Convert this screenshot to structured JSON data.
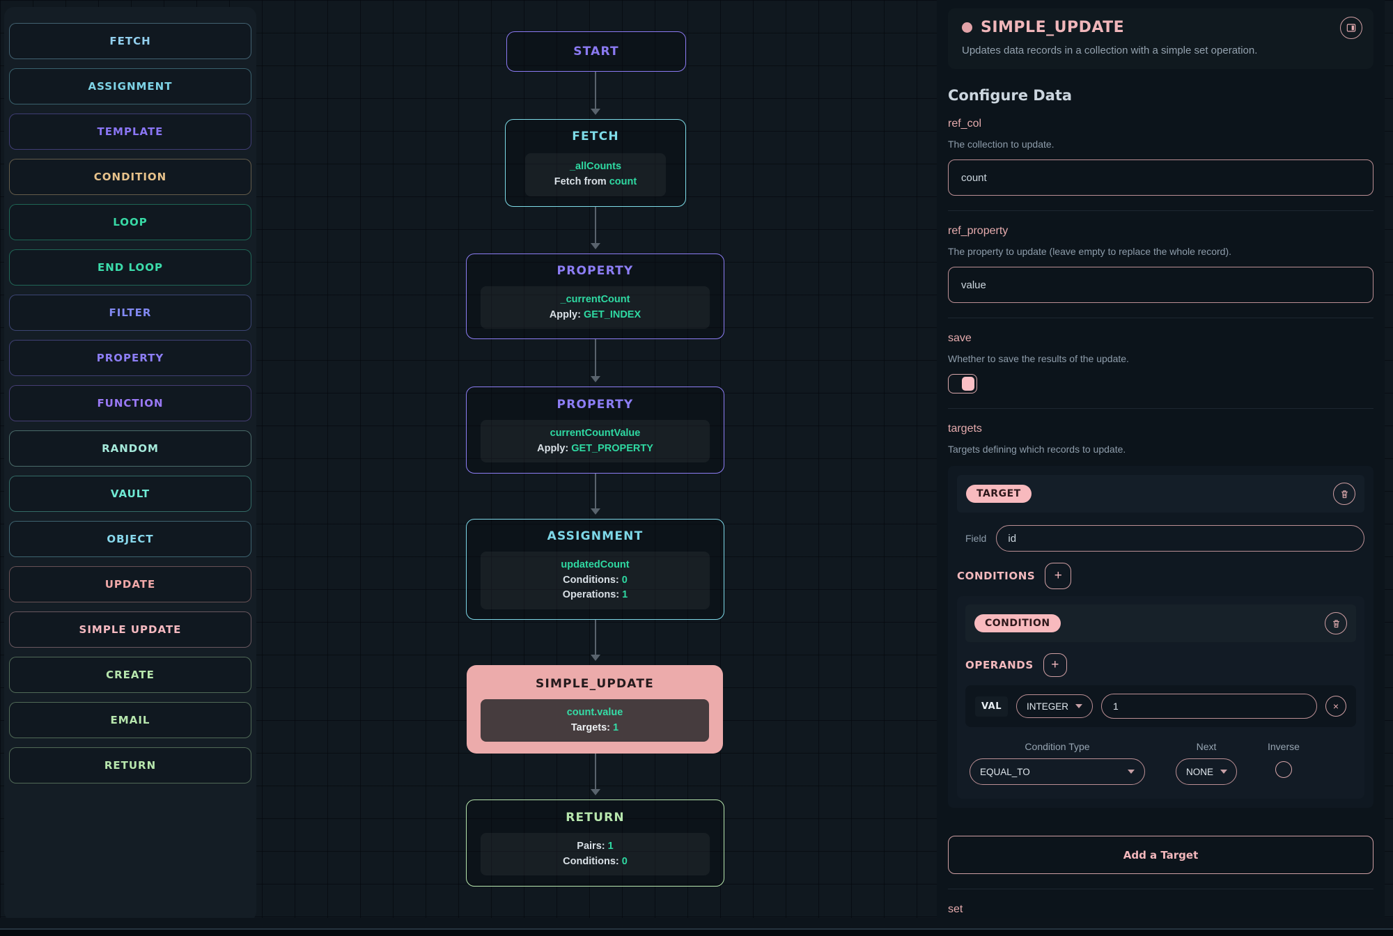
{
  "sidebar": {
    "items": [
      {
        "label": "FETCH",
        "color": "#92cfee"
      },
      {
        "label": "ASSIGNMENT",
        "color": "#7ed3e6"
      },
      {
        "label": "TEMPLATE",
        "color": "#8a76f4"
      },
      {
        "label": "CONDITION",
        "color": "#e7c28b"
      },
      {
        "label": "LOOP",
        "color": "#38d9a5"
      },
      {
        "label": "END LOOP",
        "color": "#3cdcab"
      },
      {
        "label": "FILTER",
        "color": "#8289f2"
      },
      {
        "label": "PROPERTY",
        "color": "#8d7ef5"
      },
      {
        "label": "FUNCTION",
        "color": "#9a79f6"
      },
      {
        "label": "RANDOM",
        "color": "#a5e9da"
      },
      {
        "label": "VAULT",
        "color": "#6fe9d3"
      },
      {
        "label": "OBJECT",
        "color": "#88d8ec"
      },
      {
        "label": "UPDATE",
        "color": "#f0a8a8"
      },
      {
        "label": "SIMPLE UPDATE",
        "color": "#f6bac1"
      },
      {
        "label": "CREATE",
        "color": "#b7e6ad"
      },
      {
        "label": "EMAIL",
        "color": "#b7e6ad"
      },
      {
        "label": "RETURN",
        "color": "#b7e6ad"
      }
    ]
  },
  "canvas": {
    "nodes": {
      "start": {
        "title": "START",
        "color": "#8b7af2"
      },
      "fetch": {
        "title": "FETCH",
        "color": "#7edce8",
        "name": "_allCounts",
        "detail_prefix": "Fetch from ",
        "detail_value": "count"
      },
      "property1": {
        "title": "PROPERTY",
        "color": "#8d7ef5",
        "name": "_currentCount",
        "detail_prefix": "Apply: ",
        "detail_value": "GET_INDEX"
      },
      "property2": {
        "title": "PROPERTY",
        "color": "#8d7ef5",
        "name": "currentCountValue",
        "detail_prefix": "Apply: ",
        "detail_value": "GET_PROPERTY"
      },
      "assignment": {
        "title": "ASSIGNMENT",
        "color": "#7ed8e8",
        "name": "updatedCount",
        "line1_prefix": "Conditions: ",
        "line1_value": "0",
        "line2_prefix": "Operations: ",
        "line2_value": "1"
      },
      "simple_update": {
        "title": "SIMPLE_UPDATE",
        "bg": "#ecabab",
        "name": "count.value",
        "line1_prefix": "Targets: ",
        "line1_value": "1"
      },
      "return": {
        "title": "RETURN",
        "color": "#b7e6ad",
        "line1_prefix": "Pairs: ",
        "line1_value": "1",
        "line2_prefix": "Conditions: ",
        "line2_value": "0"
      }
    }
  },
  "panel": {
    "title": "SIMPLE_UPDATE",
    "description": "Updates data records in a collection with a simple set operation.",
    "section_heading": "Configure Data",
    "ref_col": {
      "label": "ref_col",
      "help": "The collection to update.",
      "value": "count"
    },
    "ref_property": {
      "label": "ref_property",
      "help": "The property to update (leave empty to replace the whole record).",
      "value": "value"
    },
    "save": {
      "label": "save",
      "help": "Whether to save the results of the update.",
      "state": "on"
    },
    "targets": {
      "label": "targets",
      "help": "Targets defining which records to update."
    },
    "target": {
      "badge": "TARGET",
      "field_label": "Field",
      "field_value": "id",
      "conditions_label": "CONDITIONS",
      "condition": {
        "badge": "CONDITION",
        "operands_label": "OPERANDS",
        "operand": {
          "kind": "VAL",
          "type": "INTEGER",
          "value": "1"
        },
        "condition_type_label": "Condition Type",
        "condition_type_value": "EQUAL_TO",
        "next_label": "Next",
        "next_value": "NONE",
        "inverse_label": "Inverse"
      }
    },
    "add_target_label": "Add a Target",
    "set_label": "set",
    "accent_color": "#f0b6ba"
  }
}
